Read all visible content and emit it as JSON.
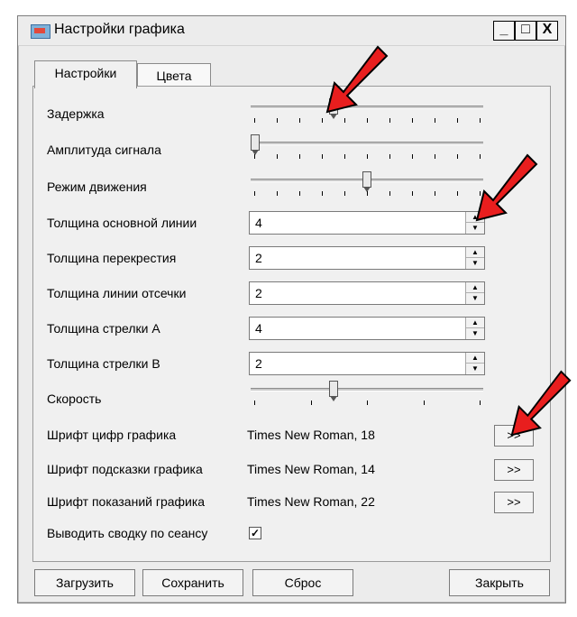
{
  "window": {
    "title": "Настройки графика",
    "buttons": {
      "minimize": "_",
      "maximize": "□",
      "close": "X"
    }
  },
  "tabs": [
    {
      "label": "Настройки",
      "active": true
    },
    {
      "label": "Цвета",
      "active": false
    }
  ],
  "settings": {
    "delay": {
      "label": "Задержка",
      "value": 0.35
    },
    "amplitude": {
      "label": "Амплитуда сигнала",
      "value": 0.0
    },
    "motion_mode": {
      "label": "Режим движения",
      "value": 0.5
    },
    "main_line_thickness": {
      "label": "Толщина основной линии",
      "value": "4"
    },
    "crosshair_thickness": {
      "label": "Толщина перекрестия",
      "value": "2"
    },
    "cutoff_line_thickness": {
      "label": "Толщина линии отсечки",
      "value": "2"
    },
    "arrow_a_thickness": {
      "label": "Толщина стрелки А",
      "value": "4"
    },
    "arrow_b_thickness": {
      "label": "Толщина стрелки В",
      "value": "2"
    },
    "speed": {
      "label": "Скорость",
      "value": 0.35
    },
    "digits_font": {
      "label": "Шрифт цифр графика",
      "value": "Times New Roman, 18",
      "button": ">>"
    },
    "hint_font": {
      "label": "Шрифт подсказки графика",
      "value": "Times New Roman, 14",
      "button": ">>"
    },
    "readings_font": {
      "label": "Шрифт показаний графика",
      "value": "Times New Roman, 22",
      "button": ">>"
    },
    "session_summary": {
      "label": "Выводить сводку по сеансу",
      "checked": true,
      "check_glyph": "✓"
    }
  },
  "footer": {
    "load": "Загрузить",
    "save": "Сохранить",
    "reset": "Сброс",
    "close": "Закрыть"
  },
  "icons": {
    "spin_up": "▲",
    "spin_down": "▼"
  },
  "colors": {
    "annotation_arrow": "#e81e1e"
  }
}
